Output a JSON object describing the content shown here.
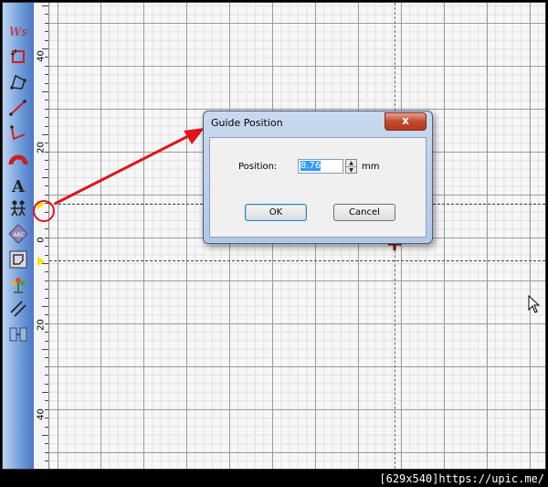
{
  "ruler": {
    "labels": [
      "40",
      "20",
      "0",
      "20",
      "40"
    ]
  },
  "toolbar": {
    "icons": [
      "signature-icon",
      "crop-icon",
      "polygon-icon",
      "line-icon",
      "polyline-icon",
      "stamp-icon",
      "text-icon",
      "people-icon",
      "badge-icon",
      "frame-icon",
      "flower-icon",
      "parallel-lines-icon",
      "align-icon"
    ]
  },
  "dialog": {
    "title": "Guide Position",
    "close_label": "x",
    "position_label": "Position:",
    "position_value": "8.76",
    "unit": "mm",
    "ok_label": "OK",
    "cancel_label": "Cancel"
  },
  "footer": {
    "watermark": "[629x540]https://upic.me/"
  },
  "colors": {
    "arrow": "#e0141c",
    "guide_marker": "#f5e300",
    "toolbar": "#6f9ad8"
  }
}
